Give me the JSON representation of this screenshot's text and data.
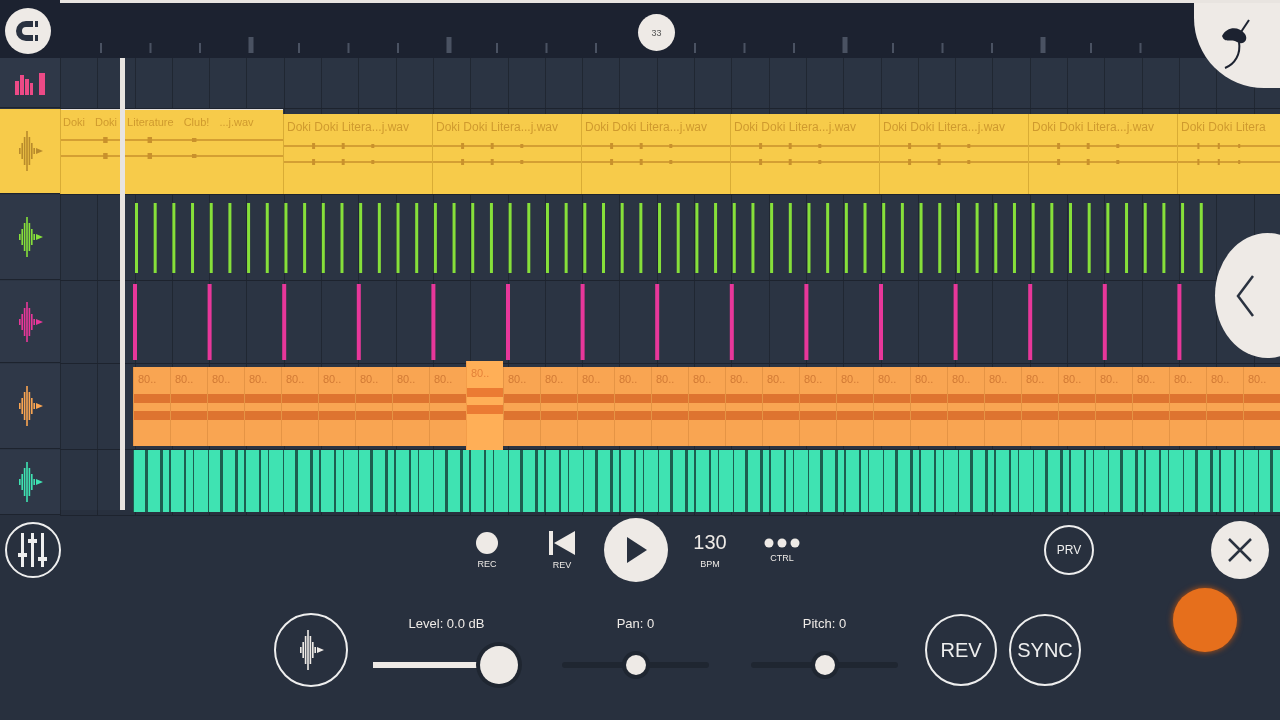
{
  "ruler": {
    "position_marker": "33"
  },
  "tracks": [
    {
      "kind": "meter",
      "color": "#ec4a86",
      "selected": false
    },
    {
      "kind": "audio",
      "color": "#f7cb4a",
      "selected": true,
      "clips": [
        {
          "label": "Doki Doki Literature Club! ...j.wav"
        },
        {
          "label": "Doki Doki Litera...j.wav"
        },
        {
          "label": "Doki Doki Litera...j.wav"
        },
        {
          "label": "Doki Doki Litera...j.wav"
        },
        {
          "label": "Doki Doki Litera...j.wav"
        },
        {
          "label": "Doki Doki Litera...j.wav"
        },
        {
          "label": "Doki Doki Litera...j.wav"
        },
        {
          "label": "Doki Doki Litera"
        }
      ]
    },
    {
      "kind": "notes",
      "color": "#86e03a",
      "selected": false
    },
    {
      "kind": "hits",
      "color": "#e8379a",
      "selected": false
    },
    {
      "kind": "slices",
      "color": "#f9a552",
      "selected": false,
      "clips": [
        {
          "label": "80..",
          "selected": false
        },
        {
          "label": "80..",
          "selected": false
        },
        {
          "label": "80..",
          "selected": false
        },
        {
          "label": "80..",
          "selected": false
        },
        {
          "label": "80..",
          "selected": false
        },
        {
          "label": "80..",
          "selected": false
        },
        {
          "label": "80..",
          "selected": false
        },
        {
          "label": "80..",
          "selected": false
        },
        {
          "label": "80..",
          "selected": false
        },
        {
          "label": "80..",
          "selected": true
        },
        {
          "label": "80..",
          "selected": false
        },
        {
          "label": "80..",
          "selected": false
        },
        {
          "label": "80..",
          "selected": false
        },
        {
          "label": "80..",
          "selected": false
        },
        {
          "label": "80..",
          "selected": false
        },
        {
          "label": "80..",
          "selected": false
        },
        {
          "label": "80..",
          "selected": false
        },
        {
          "label": "80..",
          "selected": false
        },
        {
          "label": "80..",
          "selected": false
        },
        {
          "label": "80..",
          "selected": false
        },
        {
          "label": "80..",
          "selected": false
        },
        {
          "label": "80..",
          "selected": false
        },
        {
          "label": "80..",
          "selected": false
        },
        {
          "label": "80..",
          "selected": false
        },
        {
          "label": "80..",
          "selected": false
        },
        {
          "label": "80..",
          "selected": false
        },
        {
          "label": "80..",
          "selected": false
        },
        {
          "label": "80..",
          "selected": false
        },
        {
          "label": "80..",
          "selected": false
        },
        {
          "label": "80..",
          "selected": false
        },
        {
          "label": "80..",
          "selected": false
        }
      ]
    },
    {
      "kind": "wave",
      "color": "#3fe3b2",
      "selected": false
    }
  ],
  "transport": [
    {
      "kind": "rec",
      "label": "REC"
    },
    {
      "kind": "rewind",
      "label": "REV"
    },
    {
      "kind": "play"
    },
    {
      "kind": "value",
      "value": "130",
      "label": "BPM"
    },
    {
      "kind": "more",
      "label": "CTRL"
    }
  ],
  "preview_button": "PRV",
  "sliders": [
    {
      "kind": "filled",
      "label": "Level: 0.0 dB",
      "level": 0.86
    },
    {
      "kind": "plain",
      "label": "Pan: 0",
      "level": 0.5
    },
    {
      "kind": "plain",
      "label": "Pitch: 0",
      "level": 0.5
    }
  ],
  "buttons": [
    "REV",
    "SYNC"
  ]
}
